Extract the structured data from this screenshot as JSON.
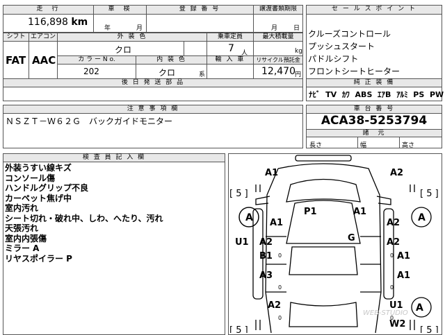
{
  "top": {
    "mileage_hdr": "走　行",
    "inspection_hdr": "車　検",
    "reg_hdr": "登 録 番 号",
    "transfer_hdr": "譲渡書類期限",
    "mileage_value": "116,898",
    "mileage_unit": "km",
    "year_unit": "年",
    "month_unit": "月",
    "transfer_month": "月",
    "transfer_day": "日"
  },
  "spec": {
    "shift_hdr": "シフト",
    "ac_hdr": "エアコン",
    "ext_color_hdr": "外 装 色",
    "capacity_hdr": "乗車定員",
    "max_load_hdr": "最大積載量",
    "shift_value": "FAT",
    "ac_value": "AAC",
    "ext_color_value": "クロ",
    "capacity_value": "7",
    "capacity_unit": "人",
    "load_unit": "kg",
    "color_no_hdr": "カ ラ ー  N o.",
    "int_color_hdr": "内 装 色",
    "import_hdr": "輸 入 車",
    "recycle_hdr": "リサイクル預託金",
    "color_no_value": "202",
    "int_color_value": "クロ",
    "int_color_suffix": "系",
    "recycle_value": "12,470",
    "recycle_unit": "円",
    "retrofit_hdr": "後 日 発 送 部 品"
  },
  "sales": {
    "hdr": "セ ー ル ス ポ イ ン ト",
    "points": [
      "クルーズコントロール",
      "プッシュスタート",
      "パドルシフト",
      "フロントシートヒーター"
    ],
    "equip_hdr": "純 正 装 備",
    "equipment": [
      "ﾅﾋﾞ",
      "TV",
      "ｶﾜ",
      "ABS",
      "ｴｱB",
      "ｱﾙﾐ",
      "PS",
      "PW"
    ]
  },
  "notes": {
    "hdr": "注 意 事 項 欄",
    "text": "ＮＳＺＴ－Ｗ６２Ｇ　バックガイドモニター"
  },
  "chassis": {
    "hdr": "車 台 番 号",
    "value": "ACA38-5253794",
    "dims_hdr": "諸　元",
    "length": "長さ",
    "width": "幅",
    "height": "高さ"
  },
  "inspector": {
    "hdr": "検 査 員 記 入 欄",
    "lines": [
      "外装うすい線キズ",
      "コンソール傷",
      "ハンドルグリップ不良",
      "カーペット焦げ中",
      "室内汚れ",
      "シート切れ・破れ中、しわ、へたり、汚れ",
      "天張汚れ",
      "室内内張傷",
      "ミラー A",
      "リヤスポイラー P"
    ]
  },
  "diagram": {
    "labels": [
      "A1",
      "A2",
      "[ 5 ]",
      "[ 5 ]",
      "A",
      "A",
      "P1",
      "A1",
      "A1",
      "A2",
      "G",
      "U1",
      "A2",
      "A2",
      "B1",
      "A1",
      "A3",
      "A1",
      "A2",
      "U1",
      "A",
      "W2",
      "[ 5 ]",
      "[ 5 ]"
    ],
    "zeros": [
      "0",
      "0",
      "0",
      "0",
      "0",
      "0"
    ]
  },
  "watermark": "WEB-STUDIO"
}
